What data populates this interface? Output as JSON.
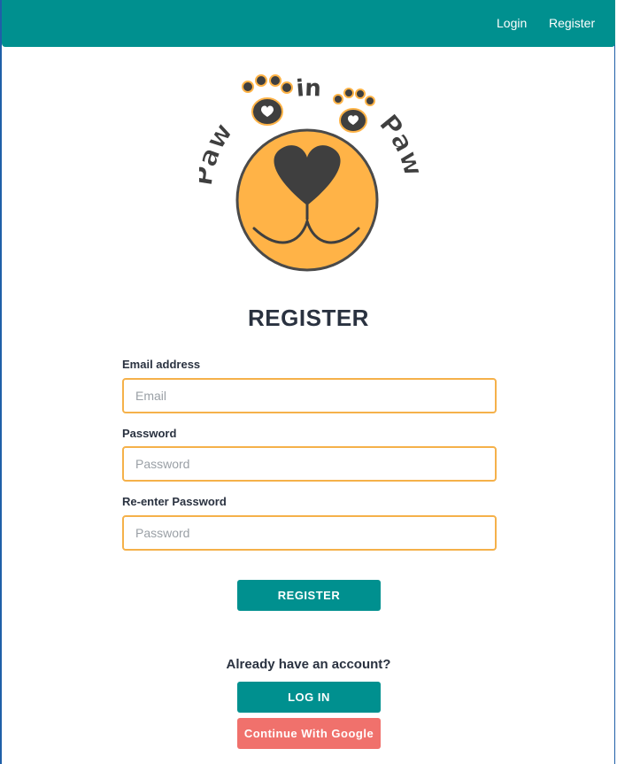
{
  "nav": {
    "login_label": "Login",
    "register_label": "Register"
  },
  "logo": {
    "word_left": "Paw",
    "word_middle": "in",
    "word_right": "Paw"
  },
  "form": {
    "title": "REGISTER",
    "email": {
      "label": "Email address",
      "placeholder": "Email",
      "value": ""
    },
    "password": {
      "label": "Password",
      "placeholder": "Password",
      "value": ""
    },
    "reenter_password": {
      "label": "Re-enter Password",
      "placeholder": "Password",
      "value": ""
    },
    "submit_label": "REGISTER"
  },
  "account": {
    "prompt": "Already have an account?",
    "login_button_label": "LOG IN",
    "google_button_label": "Continue With Google"
  },
  "colors": {
    "brand_teal": "#00908f",
    "input_border": "#f5b14a",
    "google_button": "#f0716c",
    "logo_orange": "#ffb347",
    "logo_dark": "#3f3f3f"
  }
}
